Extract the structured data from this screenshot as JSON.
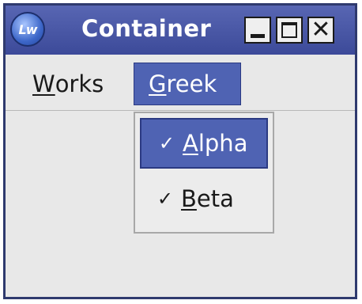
{
  "window": {
    "title": "Container",
    "logo_text": "Lw",
    "close_glyph": "✕"
  },
  "menubar": {
    "menus": [
      {
        "label_mnemonic": "W",
        "label_rest": "orks",
        "state": "normal"
      },
      {
        "label_mnemonic": "G",
        "label_rest": "reek",
        "state": "open"
      }
    ]
  },
  "dropdown": {
    "items": [
      {
        "check": "✓",
        "label_mnemonic": "A",
        "label_rest": "lpha",
        "checked": true,
        "highlighted": true
      },
      {
        "check": "✓",
        "label_mnemonic": "B",
        "label_rest": "eta",
        "checked": true,
        "highlighted": false
      }
    ]
  },
  "colors": {
    "titlebar": "#4a58a6",
    "highlight": "#4f63b3",
    "menu_background": "#e8e8e8"
  }
}
